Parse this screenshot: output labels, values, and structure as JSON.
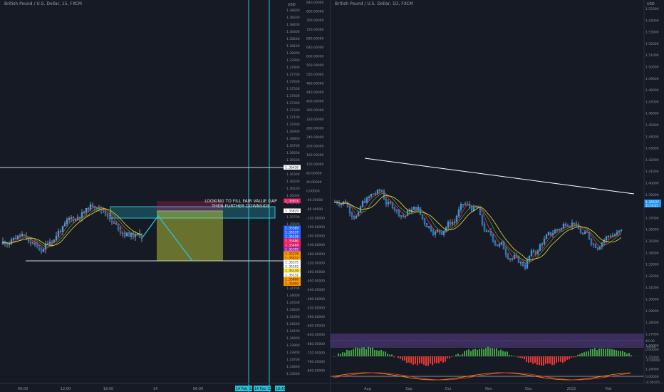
{
  "left_chart": {
    "symbol": "British Pound / U.S. Dollar, 15, FXCM",
    "currency": "USD",
    "price_ticks": [
      "1.38600",
      "1.38500",
      "1.38400",
      "1.38300",
      "1.38200",
      "1.38100",
      "1.38000",
      "1.37900",
      "1.37800",
      "1.37700",
      "1.37600",
      "1.37500",
      "1.37400",
      "1.37300",
      "1.37200",
      "1.37100",
      "1.37000",
      "1.36900",
      "1.36800",
      "1.36700",
      "1.36600",
      "1.36500",
      "1.36400",
      "1.36300",
      "1.36200",
      "1.36100",
      "1.36000",
      "1.35900",
      "1.35800",
      "1.35700",
      "1.35600",
      "1.35500",
      "1.35400",
      "1.35300",
      "1.35200",
      "1.35100",
      "1.35000",
      "1.34900",
      "1.34800",
      "1.34700",
      "1.34600",
      "1.34500",
      "1.34400",
      "1.34300",
      "1.34200",
      "1.34100",
      "1.34000",
      "1.33900",
      "1.33800",
      "1.33700",
      "1.33600",
      "1.33500"
    ],
    "osc_ticks": [
      "840.00000",
      "800.00000",
      "760.00000",
      "720.00000",
      "680.00000",
      "640.00000",
      "600.00000",
      "560.00000",
      "520.00000",
      "480.00000",
      "440.00000",
      "400.00000",
      "360.00000",
      "320.00000",
      "280.00000",
      "240.00000",
      "200.00000",
      "160.00000",
      "120.00000",
      "80.00000",
      "40.00000",
      "0.00000",
      "-40.00000",
      "-80.00000",
      "-120.00000",
      "-160.00000",
      "-200.00000",
      "-240.00000",
      "-280.00000",
      "-320.00000",
      "-360.00000",
      "-400.00000",
      "-440.00000",
      "-480.00000",
      "-520.00000",
      "-560.00000",
      "-600.00000",
      "-640.00000",
      "-680.00000",
      "-720.00000",
      "-760.00000",
      "-800.00000"
    ],
    "time_labels": [
      "06:00",
      "12:00",
      "18:00",
      "14",
      "06:00"
    ],
    "date_tags": [
      "14 Feb '22",
      "14 Feb '22",
      "18:45"
    ],
    "annotation_line1": "LOOKING TO FILL FAIR VALUE GAP",
    "annotation_line2": "THEN FURTHER DOWNSIDE",
    "price_tags": [
      {
        "text": "1.36438",
        "color": "#ffffff",
        "fg": "#131722"
      },
      {
        "text": "1.35974",
        "color": "#e91e63",
        "fg": "#ffffff"
      },
      {
        "text": "1.35829",
        "color": "#ffffff",
        "fg": "#131722"
      },
      {
        "text": "1.35569",
        "color": "#2962ff",
        "fg": "#ffffff"
      },
      {
        "text": "1.35537",
        "color": "#2962ff",
        "fg": "#ffffff"
      },
      {
        "text": "1.35510",
        "color": "#2962ff",
        "fg": "#ffffff"
      },
      {
        "text": "1.35486",
        "color": "#e91e63",
        "fg": "#ffffff"
      },
      {
        "text": "1.35464",
        "color": "#e91e63",
        "fg": "#ffffff"
      },
      {
        "text": "1.35395",
        "color": "#9c27b0",
        "fg": "#ffffff"
      },
      {
        "text": "1.35378",
        "color": "#ff9800",
        "fg": "#131722"
      },
      {
        "text": "1.35332",
        "color": "#ff9800",
        "fg": "#131722"
      },
      {
        "text": "1.35175",
        "color": "#ffffff",
        "fg": "#131722"
      },
      {
        "text": "1.35152",
        "color": "#ffffff",
        "fg": "#131722"
      },
      {
        "text": "1.35139",
        "color": "#ffeb3b",
        "fg": "#131722"
      },
      {
        "text": "1.35132",
        "color": "#ffffff",
        "fg": "#131722"
      },
      {
        "text": "1.35098",
        "color": "#ff9800",
        "fg": "#131722"
      },
      {
        "text": "1.35059",
        "color": "#ff9800",
        "fg": "#131722"
      }
    ]
  },
  "right_chart": {
    "symbol": "British Pound / U.S. Dollar, 1D, FXCM",
    "currency": "USD",
    "price_ticks": [
      "1.55000",
      "1.54000",
      "1.53000",
      "1.52000",
      "1.51000",
      "1.50000",
      "1.49000",
      "1.48000",
      "1.47000",
      "1.46000",
      "1.45000",
      "1.44000",
      "1.43000",
      "1.42000",
      "1.41000",
      "1.40000",
      "1.39000",
      "1.38000",
      "1.37000",
      "1.36000",
      "1.35000",
      "1.34000",
      "1.33000",
      "1.32000",
      "1.31000",
      "1.30000",
      "1.29000",
      "1.28000",
      "1.27000",
      "1.26000",
      "1.25000",
      "1.24000"
    ],
    "last_price": "1.35537",
    "last_price_sub": "11:14:25",
    "osc1_ticks": [
      "40.00",
      "-40.00"
    ],
    "osc2_ticks": [
      "0.00000",
      "-0.00000"
    ],
    "osc3_ticks": [
      "0.00000",
      "-0.00305"
    ],
    "time_labels": [
      "Aug",
      "Sep",
      "Oct",
      "Nov",
      "Dec",
      "2022",
      "Feb"
    ],
    "colors": {
      "bull": "#2196f3",
      "bear": "#2196f3",
      "trend": "#ffffff",
      "macd_up": "#26a69a",
      "macd_down": "#ef5350",
      "ma_red": "#e53935",
      "ma_green": "#43a047",
      "ma_yellow": "#fdd835"
    }
  }
}
